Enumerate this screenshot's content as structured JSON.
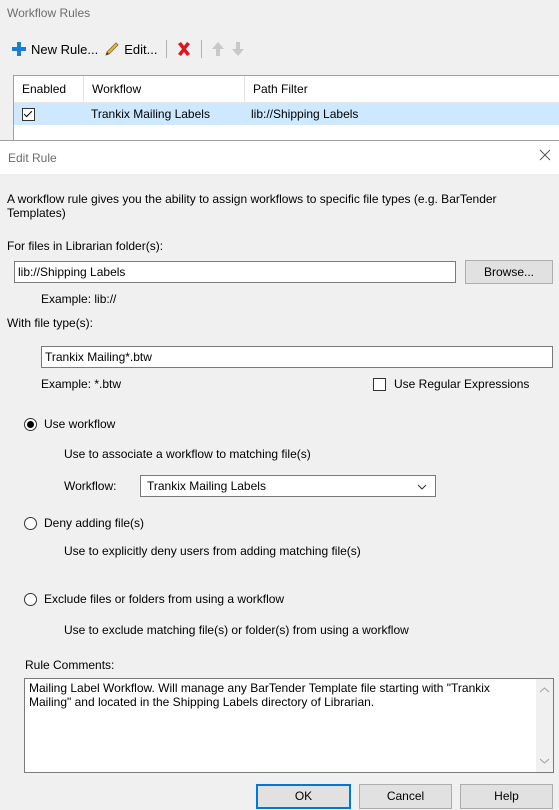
{
  "bg_window": {
    "title": "Workflow Rules",
    "toolbar": {
      "new_rule_label": "New Rule...",
      "edit_label": "Edit..."
    },
    "grid": {
      "columns": [
        "Enabled",
        "Workflow",
        "Path Filter"
      ],
      "rows": [
        {
          "enabled": true,
          "workflow": "Trankix Mailing Labels",
          "path_filter": "lib://Shipping Labels"
        }
      ]
    }
  },
  "dialog": {
    "title": "Edit Rule",
    "intro": "A workflow rule gives you the ability to assign workflows to specific file types (e.g. BarTender Templates)",
    "folder": {
      "label": "For files in Librarian folder(s):",
      "value": "lib://Shipping Labels",
      "browse_label": "Browse...",
      "example": "Example: lib://"
    },
    "filetype": {
      "label": "With file type(s):",
      "value": "Trankix Mailing*.btw",
      "example": "Example: *.btw",
      "regex_label": "Use Regular Expressions",
      "regex_checked": false
    },
    "options": {
      "use_workflow": {
        "label": "Use workflow",
        "desc": "Use to associate a workflow to matching file(s)",
        "workflow_label": "Workflow:",
        "workflow_value": "Trankix Mailing Labels",
        "checked": true
      },
      "deny": {
        "label": "Deny adding file(s)",
        "desc": "Use to explicitly deny users from adding matching file(s)",
        "checked": false
      },
      "exclude": {
        "label": "Exclude files or folders from using a workflow",
        "desc": "Use to exclude matching file(s) or folder(s) from using a workflow",
        "checked": false
      }
    },
    "comments": {
      "label": "Rule Comments:",
      "value": "Mailing Label Workflow.  Will manage any BarTender Template file starting with \"Trankix Mailing\" and located in the Shipping Labels directory of Librarian."
    },
    "buttons": {
      "ok": "OK",
      "cancel": "Cancel",
      "help": "Help"
    }
  }
}
